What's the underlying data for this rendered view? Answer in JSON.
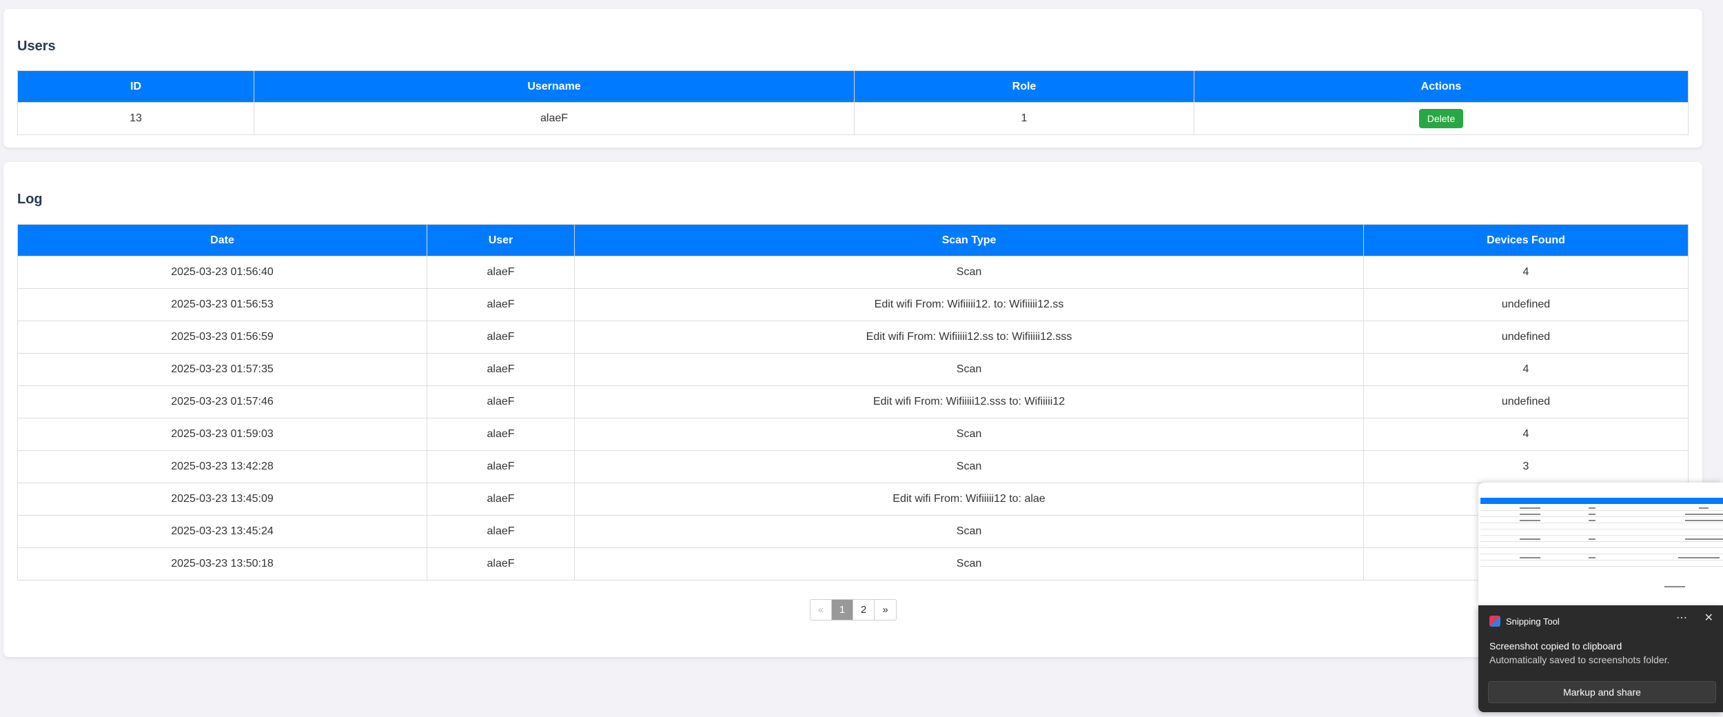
{
  "users": {
    "title": "Users",
    "columns": [
      "ID",
      "Username",
      "Role",
      "Actions"
    ],
    "rows": [
      {
        "id": "13",
        "username": "alaeF",
        "role": "1",
        "action_label": "Delete"
      }
    ]
  },
  "log": {
    "title": "Log",
    "columns": [
      "Date",
      "User",
      "Scan Type",
      "Devices Found"
    ],
    "rows": [
      {
        "date": "2025-03-23 01:56:40",
        "user": "alaeF",
        "scan_type": "Scan",
        "devices": "4"
      },
      {
        "date": "2025-03-23 01:56:53",
        "user": "alaeF",
        "scan_type": "Edit wifi From: Wifiiiii12. to: Wifiiiii12.ss",
        "devices": "undefined"
      },
      {
        "date": "2025-03-23 01:56:59",
        "user": "alaeF",
        "scan_type": "Edit wifi From: Wifiiiii12.ss to: Wifiiiii12.sss",
        "devices": "undefined"
      },
      {
        "date": "2025-03-23 01:57:35",
        "user": "alaeF",
        "scan_type": "Scan",
        "devices": "4"
      },
      {
        "date": "2025-03-23 01:57:46",
        "user": "alaeF",
        "scan_type": "Edit wifi From: Wifiiiii12.sss to: Wifiiiii12",
        "devices": "undefined"
      },
      {
        "date": "2025-03-23 01:59:03",
        "user": "alaeF",
        "scan_type": "Scan",
        "devices": "4"
      },
      {
        "date": "2025-03-23 13:42:28",
        "user": "alaeF",
        "scan_type": "Scan",
        "devices": "3"
      },
      {
        "date": "2025-03-23 13:45:09",
        "user": "alaeF",
        "scan_type": "Edit wifi From: Wifiiiii12 to: alae",
        "devices": ""
      },
      {
        "date": "2025-03-23 13:45:24",
        "user": "alaeF",
        "scan_type": "Scan",
        "devices": ""
      },
      {
        "date": "2025-03-23 13:50:18",
        "user": "alaeF",
        "scan_type": "Scan",
        "devices": ""
      }
    ],
    "pagination": {
      "prev": "«",
      "pages": [
        "1",
        "2"
      ],
      "active": "1",
      "next": "»"
    }
  },
  "toast": {
    "app_name": "Snipping Tool",
    "more_icon": "more-icon",
    "close_icon": "close-icon",
    "title": "Screenshot copied to clipboard",
    "body": "Automatically saved to screenshots folder.",
    "button_label": "Markup and share"
  },
  "colors": {
    "primary": "#007bff",
    "success": "#28a745",
    "heading": "#243a52",
    "toast_bg": "#2b2b2b"
  }
}
